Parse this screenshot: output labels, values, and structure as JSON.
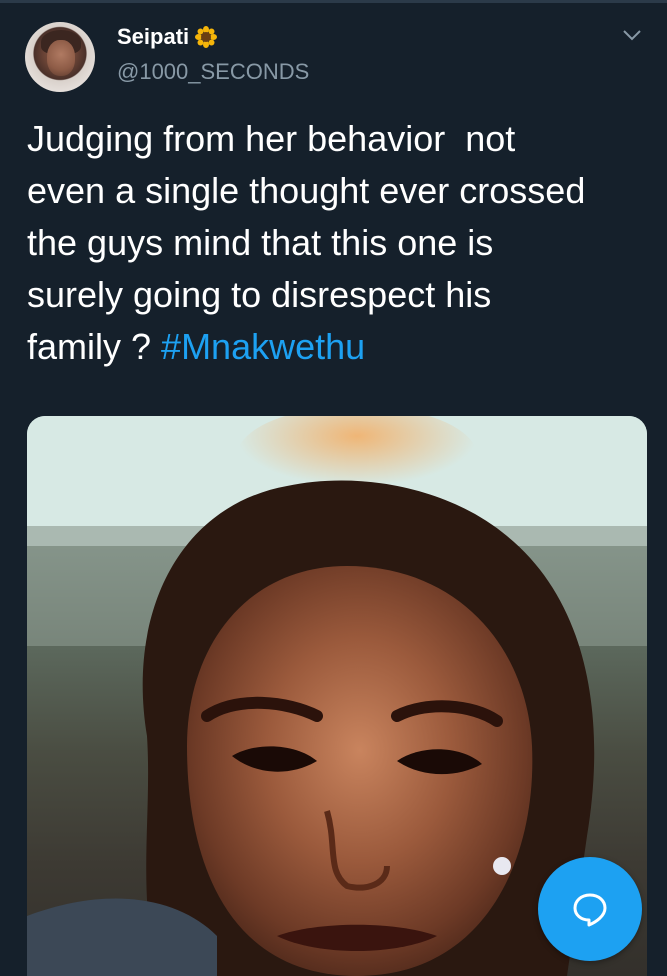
{
  "tweet": {
    "author_name": "Seipati",
    "author_emoji": "sunflower-icon",
    "author_handle": "@1000_SECONDS",
    "text": "Judging from her behavior  not\neven a single thought ever crossed\nthe guys mind that this one is\nsurely going to disrespect his\nfamily ? ",
    "hashtag": "#Mnakwethu"
  },
  "colors": {
    "background": "#15202b",
    "text": "#ffffff",
    "secondary_text": "#8899a6",
    "accent": "#1da1f2"
  },
  "icons": {
    "menu": "chevron-down-icon",
    "fab": "compose-reply-icon"
  }
}
